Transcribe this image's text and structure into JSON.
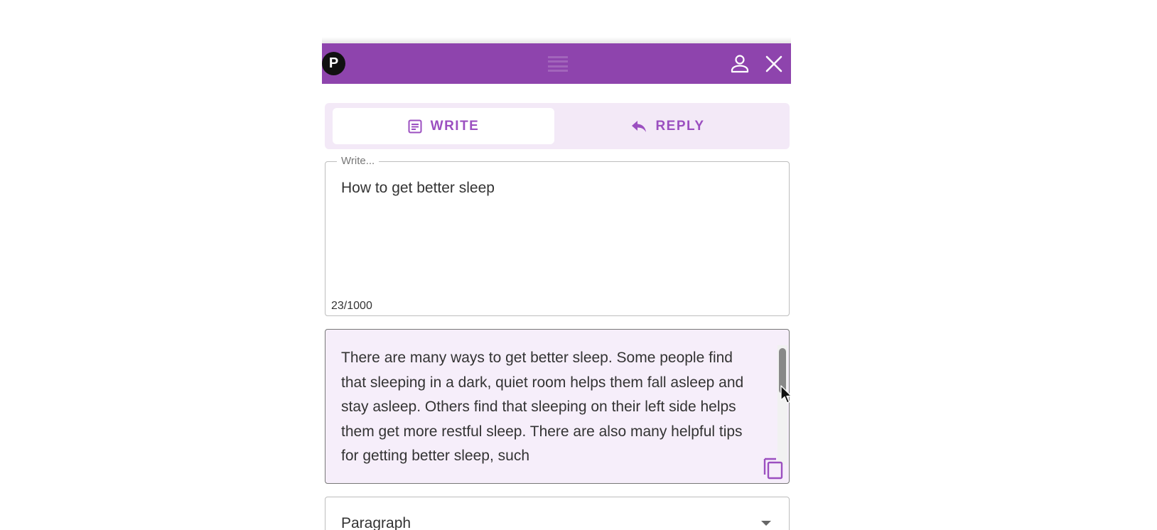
{
  "header": {
    "logo_text": "P",
    "icons": [
      "drag-handle-icon",
      "user-icon",
      "close-icon"
    ],
    "color": "#8e44ad"
  },
  "tabs": [
    {
      "label": "WRITE",
      "icon": "document-icon",
      "active": true
    },
    {
      "label": "REPLY",
      "icon": "reply-icon",
      "active": false
    }
  ],
  "write": {
    "legend": "Write...",
    "value": "How to get better sleep",
    "counter": "23/1000"
  },
  "output": {
    "text": "There are many ways to get better sleep. Some people find that sleeping in a dark, quiet room helps them fall asleep and stay asleep. Others find that sleeping on their left side helps them get more restful sleep. There are also many helpful tips for getting better sleep, such",
    "copy_icon": "copy-icon"
  },
  "format_select": {
    "value": "Paragraph"
  },
  "colors": {
    "accent": "#8e44ad",
    "tab_text": "#9b4fc0",
    "tab_bg": "#f3e9f7",
    "output_bg": "#f6eefa"
  }
}
